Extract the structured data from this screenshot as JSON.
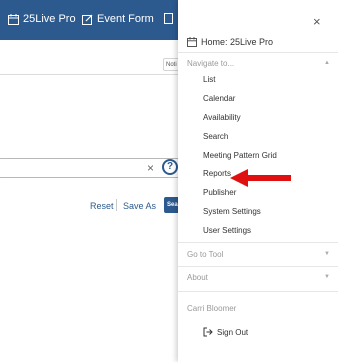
{
  "colors": {
    "brand": "#2c5a8f",
    "annotation": "#e01010"
  },
  "topbar": {
    "items": [
      {
        "icon": "calendar-icon",
        "label": "25Live Pro"
      },
      {
        "icon": "edit-icon",
        "label": "Event Form"
      }
    ]
  },
  "background": {
    "notifications_chip": "Noti",
    "clear_glyph": "×",
    "help_glyph": "?",
    "reset_label": "Reset",
    "save_as_label": "Save As",
    "search_button_label": "Search"
  },
  "menu": {
    "close_glyph": "×",
    "home_label": "Home: 25Live Pro",
    "navigate_header": "Navigate to...",
    "navigate_items": [
      "List",
      "Calendar",
      "Availability",
      "Search",
      "Meeting Pattern Grid",
      "Reports",
      "Publisher",
      "System Settings",
      "User Settings"
    ],
    "go_to_tool_header": "Go to Tool",
    "about_header": "About",
    "user_name": "Carri Bloomer",
    "sign_out_label": "Sign Out"
  }
}
